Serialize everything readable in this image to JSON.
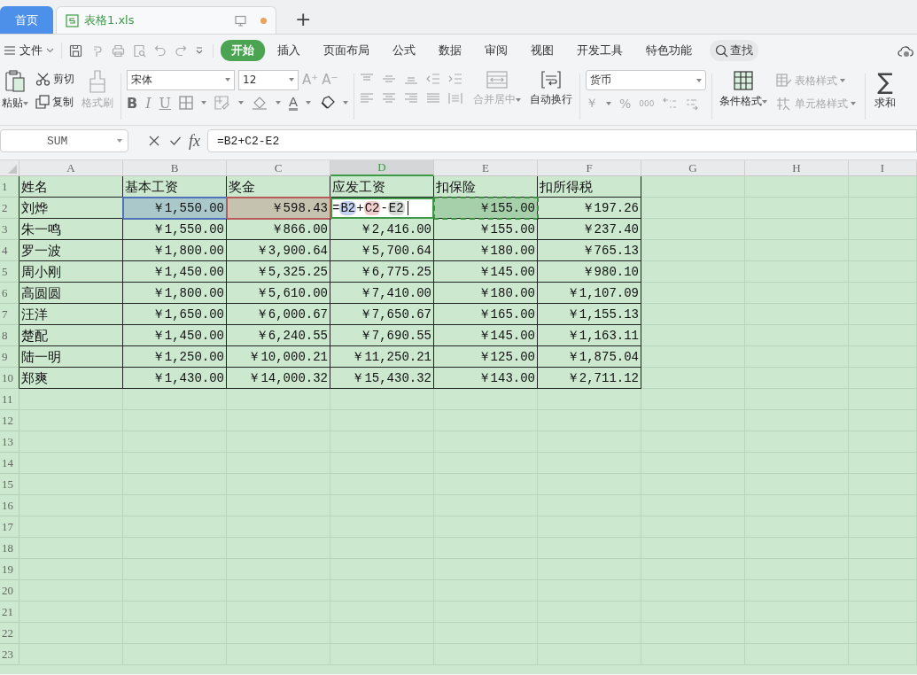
{
  "tabs": [
    {
      "label": "首页",
      "kind": "home",
      "selected": false
    },
    {
      "label": "表格1.xls",
      "kind": "file",
      "selected": true,
      "unsaved": true
    }
  ],
  "new_tab": "+",
  "menu": {
    "file": "文件",
    "ribbon_tabs": [
      {
        "label": "开始",
        "selected": true
      },
      {
        "label": "插入",
        "selected": false
      },
      {
        "label": "页面布局",
        "selected": false
      },
      {
        "label": "公式",
        "selected": false
      },
      {
        "label": "数据",
        "selected": false
      },
      {
        "label": "审阅",
        "selected": false
      },
      {
        "label": "视图",
        "selected": false
      },
      {
        "label": "开发工具",
        "selected": false
      },
      {
        "label": "特色功能",
        "selected": false
      }
    ],
    "search": "查找"
  },
  "ribbon": {
    "paste": {
      "label": "粘贴",
      "disabled": false
    },
    "cut": {
      "label": "剪切",
      "disabled": false
    },
    "copy": {
      "label": "复制",
      "disabled": false
    },
    "format_painter": {
      "label": "格式刷",
      "disabled": true
    },
    "font": {
      "name": "宋体",
      "size": "12",
      "grow": "A⁺",
      "shrink": "A⁻",
      "styles": [
        "B",
        "I",
        "U"
      ],
      "font_color": "A"
    },
    "merge": {
      "label": "合并居中",
      "disabled": true
    },
    "wrap": {
      "label": "自动换行",
      "disabled": false
    },
    "number": {
      "format": "货币",
      "symbols": [
        "￥",
        "%",
        "000"
      ]
    },
    "conditional": {
      "label": "条件格式",
      "disabled": false
    },
    "table_style": {
      "label": "表格样式",
      "disabled": true
    },
    "cell_style": {
      "label": "单元格样式",
      "disabled": true
    },
    "sum": {
      "symbol": "∑",
      "label": "求和",
      "disabled": false
    }
  },
  "formula_bar": {
    "name_box": "SUM",
    "fx": "fx",
    "formula": "=B2+C2-E2"
  },
  "sheet": {
    "columns": [
      {
        "label": "A",
        "selected": false
      },
      {
        "label": "B",
        "selected": false
      },
      {
        "label": "C",
        "selected": false
      },
      {
        "label": "D",
        "selected": true
      },
      {
        "label": "E",
        "selected": false
      },
      {
        "label": "F",
        "selected": false
      },
      {
        "label": "G",
        "selected": false
      },
      {
        "label": "H",
        "selected": false
      },
      {
        "label": "I",
        "selected": false
      }
    ],
    "rows": [
      {
        "label": "1",
        "cells": [
          "姓名",
          "基本工资",
          "奖金",
          "应发工资",
          "扣保险",
          "扣所得税"
        ]
      },
      {
        "label": "2",
        "cells": [
          "刘烨",
          {
            "text": "￥1,550.00",
            "color": "#4f72b8",
            "dashed": false
          },
          {
            "text": "￥598.43",
            "color": "#b85a5a",
            "dashed": false
          },
          {
            "editing": true,
            "tokens": [
              {
                "text": "="
              },
              {
                "text": "B2",
                "color": "#c5d3f0"
              },
              {
                "text": "+"
              },
              {
                "text": "C2",
                "color": "#f0cccc"
              },
              {
                "text": "-"
              },
              {
                "text": "E2",
                "color": "#d6dad6"
              }
            ]
          },
          {
            "text": "￥155.00",
            "color": "#3f8f45",
            "dashed": true
          },
          "￥197.26"
        ]
      },
      {
        "label": "3",
        "cells": [
          "朱一鸣",
          "￥1,550.00",
          "￥866.00",
          "￥2,416.00",
          "￥155.00",
          "￥237.40"
        ]
      },
      {
        "label": "4",
        "cells": [
          "罗一波",
          "￥1,800.00",
          "￥3,900.64",
          "￥5,700.64",
          "￥180.00",
          "￥765.13"
        ]
      },
      {
        "label": "5",
        "cells": [
          "周小刚",
          "￥1,450.00",
          "￥5,325.25",
          "￥6,775.25",
          "￥145.00",
          "￥980.10"
        ]
      },
      {
        "label": "6",
        "cells": [
          "高圆圆",
          "￥1,800.00",
          "￥5,610.00",
          "￥7,410.00",
          "￥180.00",
          "￥1,107.09"
        ]
      },
      {
        "label": "7",
        "cells": [
          "汪洋",
          "￥1,650.00",
          "￥6,000.67",
          "￥7,650.67",
          "￥165.00",
          "￥1,155.13"
        ]
      },
      {
        "label": "8",
        "cells": [
          "楚配",
          "￥1,450.00",
          "￥6,240.55",
          "￥7,690.55",
          "￥145.00",
          "￥1,163.11"
        ]
      },
      {
        "label": "9",
        "cells": [
          "陆一明",
          "￥1,250.00",
          "￥10,000.21",
          "￥11,250.21",
          "￥125.00",
          "￥1,875.04"
        ]
      },
      {
        "label": "10",
        "cells": [
          "郑爽",
          "￥1,430.00",
          "￥14,000.32",
          "￥15,430.32",
          "￥143.00",
          "￥2,711.12"
        ]
      },
      {
        "label": "11"
      },
      {
        "label": "12"
      },
      {
        "label": "13"
      },
      {
        "label": "14"
      },
      {
        "label": "15"
      },
      {
        "label": "16"
      },
      {
        "label": "17"
      },
      {
        "label": "18"
      },
      {
        "label": "19"
      },
      {
        "label": "20"
      },
      {
        "label": "21"
      },
      {
        "label": "22"
      },
      {
        "label": "23"
      }
    ]
  }
}
